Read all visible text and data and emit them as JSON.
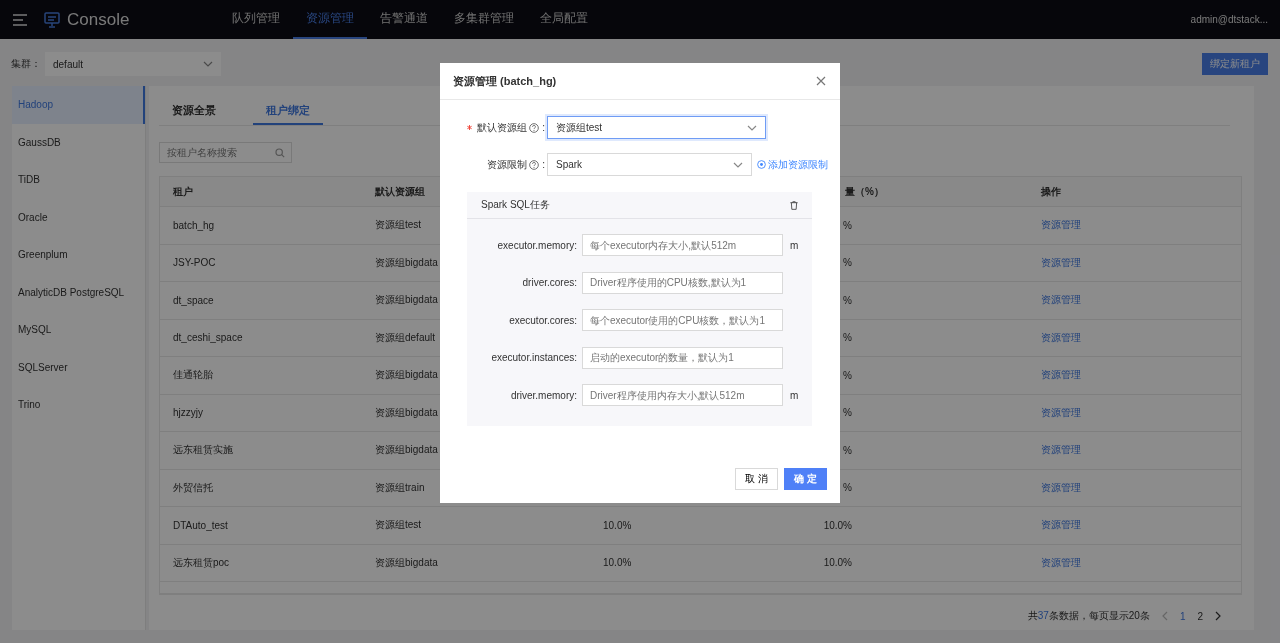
{
  "header": {
    "title": "Console",
    "nav": [
      {
        "label": "队列管理",
        "selected": false
      },
      {
        "label": "资源管理",
        "selected": true
      },
      {
        "label": "告警通道",
        "selected": false
      },
      {
        "label": "多集群管理",
        "selected": false
      },
      {
        "label": "全局配置",
        "selected": false
      }
    ],
    "user": "admin@dtstack..."
  },
  "cluster": {
    "label": "集群：",
    "value": "default"
  },
  "bind_button": "绑定新租户",
  "sidebar": [
    {
      "label": "Hadoop",
      "selected": true
    },
    {
      "label": "GaussDB",
      "selected": false
    },
    {
      "label": "TiDB",
      "selected": false
    },
    {
      "label": "Oracle",
      "selected": false
    },
    {
      "label": "Greenplum",
      "selected": false
    },
    {
      "label": "AnalyticDB PostgreSQL",
      "selected": false
    },
    {
      "label": "MySQL",
      "selected": false
    },
    {
      "label": "SQLServer",
      "selected": false
    },
    {
      "label": "Trino",
      "selected": false
    }
  ],
  "tabs": [
    {
      "label": "资源全景",
      "selected": false
    },
    {
      "label": "租户绑定",
      "selected": true
    }
  ],
  "search": {
    "placeholder": "按租户名称搜索"
  },
  "table": {
    "columns": [
      "租户",
      "默认资源组",
      "",
      "量（%）",
      "操作"
    ],
    "rows": [
      [
        "batch_hg",
        "资源组test",
        "",
        "%",
        "资源管理"
      ],
      [
        "JSY-POC",
        "资源组bigdata",
        "",
        "%",
        "资源管理"
      ],
      [
        "dt_space",
        "资源组bigdata",
        "",
        "%",
        "资源管理"
      ],
      [
        "dt_ceshi_space",
        "资源组default",
        "",
        "%",
        "资源管理"
      ],
      [
        "佳通轮胎",
        "资源组bigdata",
        "",
        "%",
        "资源管理"
      ],
      [
        "hjzzyjy",
        "资源组bigdata",
        "",
        "%",
        "资源管理"
      ],
      [
        "远东租赁实施",
        "资源组bigdata",
        "",
        "%",
        "资源管理"
      ],
      [
        "外贸信托",
        "资源组train",
        "",
        "%",
        "资源管理"
      ],
      [
        "DTAuto_test",
        "资源组test",
        "10.0%",
        "10.0%",
        "资源管理"
      ],
      [
        "远东租赁poc",
        "资源组bigdata",
        "10.0%",
        "10.0%",
        "资源管理"
      ]
    ]
  },
  "pagination": {
    "prefix": "共",
    "total": "37",
    "suffix": "条数据，每页显示20条",
    "pages": [
      {
        "label": "1",
        "selected": true
      },
      {
        "label": "2",
        "selected": false
      }
    ]
  },
  "modal": {
    "title": "资源管理 (batch_hg)",
    "default_group": {
      "label": "默认资源组",
      "required": true,
      "colon": ":",
      "value": "资源组test"
    },
    "limit": {
      "label": "资源限制",
      "required": false,
      "colon": ":",
      "value": "Spark"
    },
    "add_link": "添加资源限制",
    "panel": {
      "title": "Spark SQL任务",
      "fields": [
        {
          "label": "executor.memory:",
          "placeholder": "每个executor内存大小,默认512m",
          "unit": "m"
        },
        {
          "label": "driver.cores:",
          "placeholder": "Driver程序使用的CPU核数,默认为1"
        },
        {
          "label": "executor.cores:",
          "placeholder": "每个executor使用的CPU核数，默认为1"
        },
        {
          "label": "executor.instances:",
          "placeholder": "启动的executor的数量，默认为1"
        },
        {
          "label": "driver.memory:",
          "placeholder": "Driver程序使用内存大小,默认512m",
          "unit": "m"
        }
      ]
    },
    "cancel": "取 消",
    "ok": "确 定"
  }
}
